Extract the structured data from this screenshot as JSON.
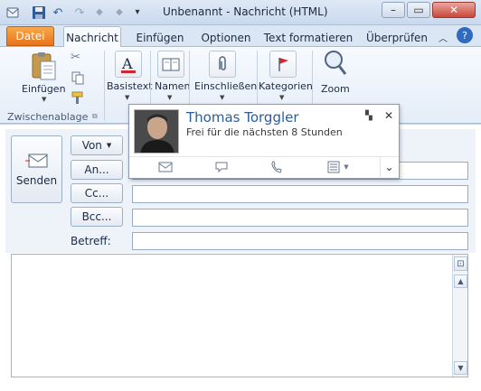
{
  "window": {
    "title": "Unbenannt - Nachricht (HTML)",
    "controls": {
      "minimize": "–",
      "maximize": "▭",
      "close": "✕"
    }
  },
  "qat": {
    "icons": [
      "outlook-app-icon",
      "save-icon",
      "undo-icon",
      "redo-icon",
      "up-arrow-icon",
      "down-arrow-icon",
      "customize-qat-icon"
    ]
  },
  "tabs": {
    "file": "Datei",
    "items": [
      "Nachricht",
      "Einfügen",
      "Optionen",
      "Text formatieren",
      "Überprüfen"
    ],
    "help": "?"
  },
  "ribbon": {
    "paste_label": "Einfügen",
    "clipboard_group": "Zwischenablage",
    "basistext_label": "Basistext",
    "namen_label": "Namen",
    "einschliessen_label": "Einschließen",
    "kategorien_label": "Kategorien",
    "zoom_label": "Zoom"
  },
  "compose": {
    "send_label": "Senden",
    "from_label": "Von",
    "to_label": "An...",
    "cc_label": "Cc...",
    "bcc_label": "Bcc...",
    "subject_label": "Betreff:",
    "to_value": "",
    "cc_value": "",
    "bcc_value": "",
    "subject_value": "",
    "body_value": ""
  },
  "contact_card": {
    "name": "Thomas Torggler",
    "status": "Frei für die nächsten 8 Stunden",
    "pin": "📌",
    "close": "✕",
    "actions": [
      "email-icon",
      "im-icon",
      "phone-icon",
      "schedule-meeting-icon"
    ],
    "expand": "⌄"
  },
  "colors": {
    "file_tab": "#e8731a",
    "accent_blue": "#2a5d9a",
    "ribbon_bg": "#e4edf8"
  }
}
